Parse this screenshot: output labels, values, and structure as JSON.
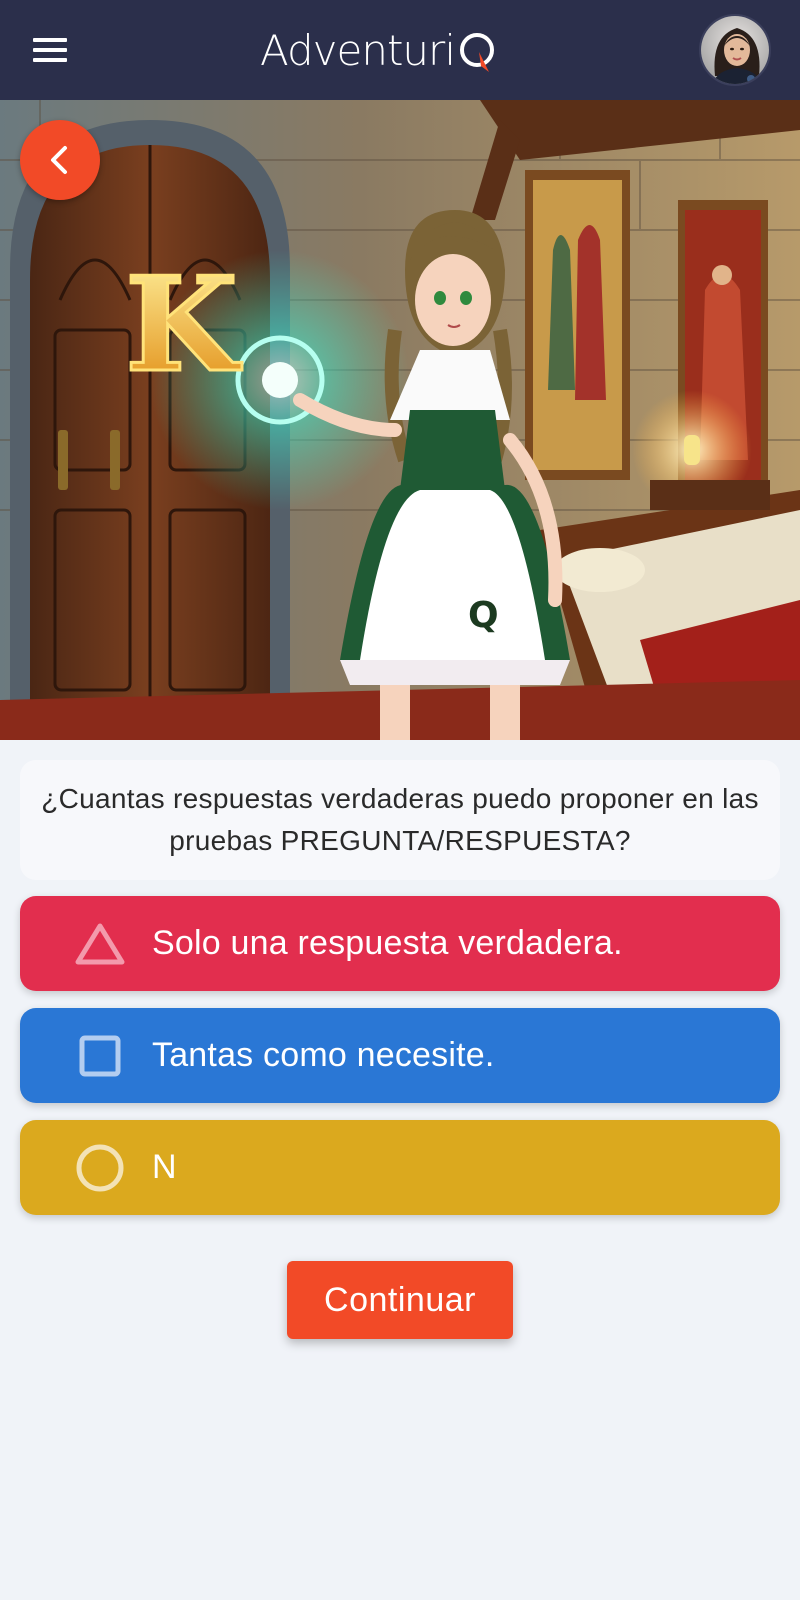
{
  "header": {
    "logo_text": "Adventuri",
    "menu_icon": "hamburger-menu-icon",
    "avatar": "user-avatar"
  },
  "hero": {
    "back_icon": "chevron-left-icon",
    "image": "illustration-girl-dirndl-castle-room",
    "image_letters": [
      "K",
      "Q"
    ]
  },
  "question": {
    "text": "¿Cuantas respuestas verdaderas puedo proponer en las pruebas PREGUNTA/RESPUESTA?"
  },
  "answers": [
    {
      "icon": "triangle-icon",
      "label": "Solo una respuesta verdadera.",
      "color": "#e22e4e"
    },
    {
      "icon": "square-icon",
      "label": "Tantas como necesite.",
      "color": "#2a77d5"
    },
    {
      "icon": "circle-icon",
      "label": "N",
      "color": "#dba91e"
    }
  ],
  "actions": {
    "continue_label": "Continuar",
    "continue_color": "#f24a27"
  },
  "colors": {
    "header_bg": "#2b2f4b",
    "page_bg": "#f0f3f8"
  }
}
